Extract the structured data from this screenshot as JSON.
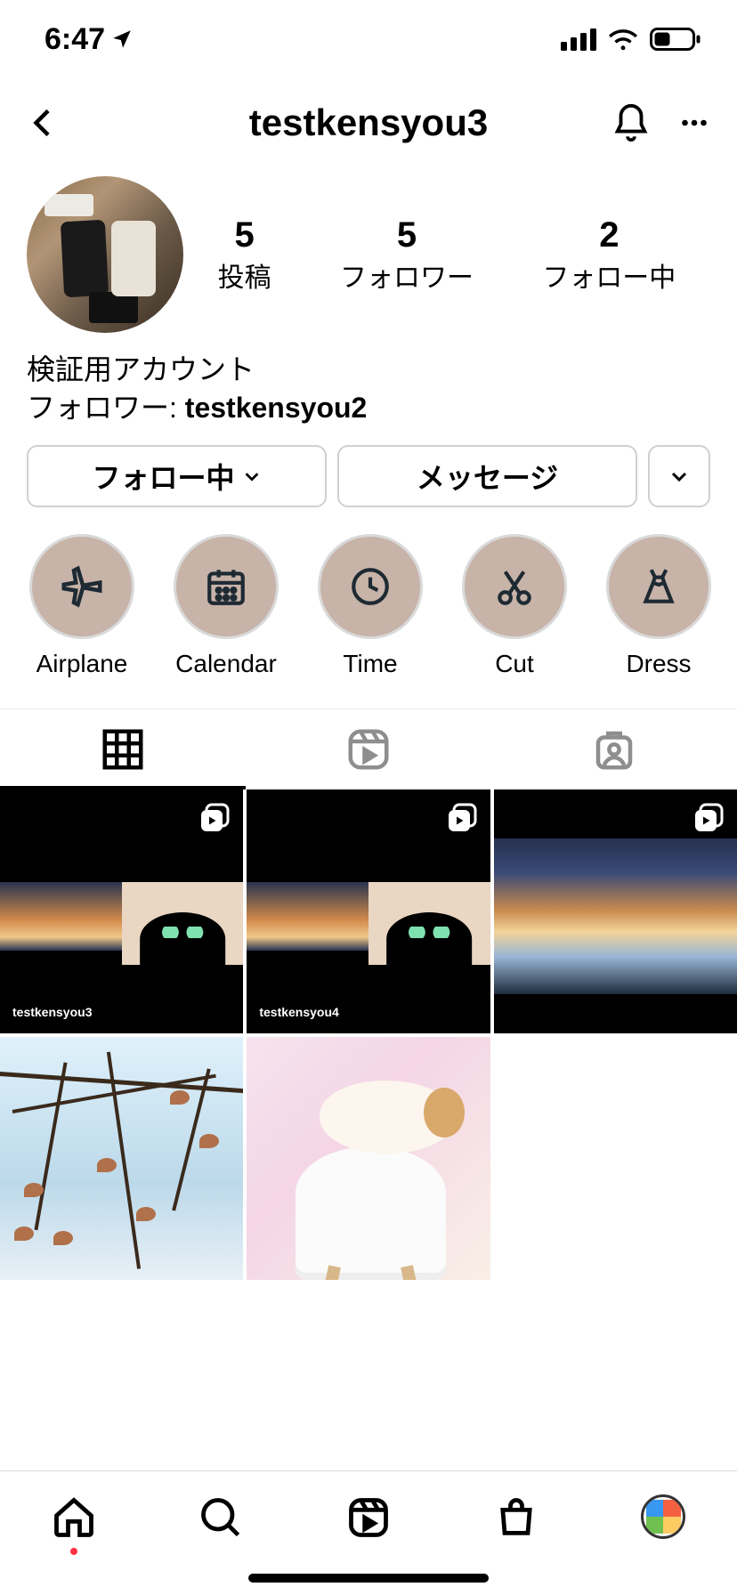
{
  "status": {
    "time": "6:47"
  },
  "nav": {
    "username": "testkensyou3"
  },
  "stats": {
    "posts": {
      "count": "5",
      "label": "投稿"
    },
    "followers": {
      "count": "5",
      "label": "フォロワー"
    },
    "following": {
      "count": "2",
      "label": "フォロー中"
    }
  },
  "bio": {
    "display_name": "検証用アカウント",
    "follower_prefix": "フォロワー: ",
    "follower_link": "testkensyou2"
  },
  "actions": {
    "follow_label": "フォロー中",
    "message_label": "メッセージ"
  },
  "highlights": [
    {
      "label": "Airplane",
      "icon": "airplane-icon"
    },
    {
      "label": "Calendar",
      "icon": "calendar-icon"
    },
    {
      "label": "Time",
      "icon": "clock-icon"
    },
    {
      "label": "Cut",
      "icon": "scissors-icon"
    },
    {
      "label": "Dress",
      "icon": "dress-icon"
    }
  ],
  "content_tabs": {
    "active": "grid"
  },
  "posts": [
    {
      "type": "reel",
      "caption": "testkensyou3"
    },
    {
      "type": "reel",
      "caption": "testkensyou4"
    },
    {
      "type": "reel",
      "caption": ""
    },
    {
      "type": "image"
    },
    {
      "type": "image"
    }
  ]
}
